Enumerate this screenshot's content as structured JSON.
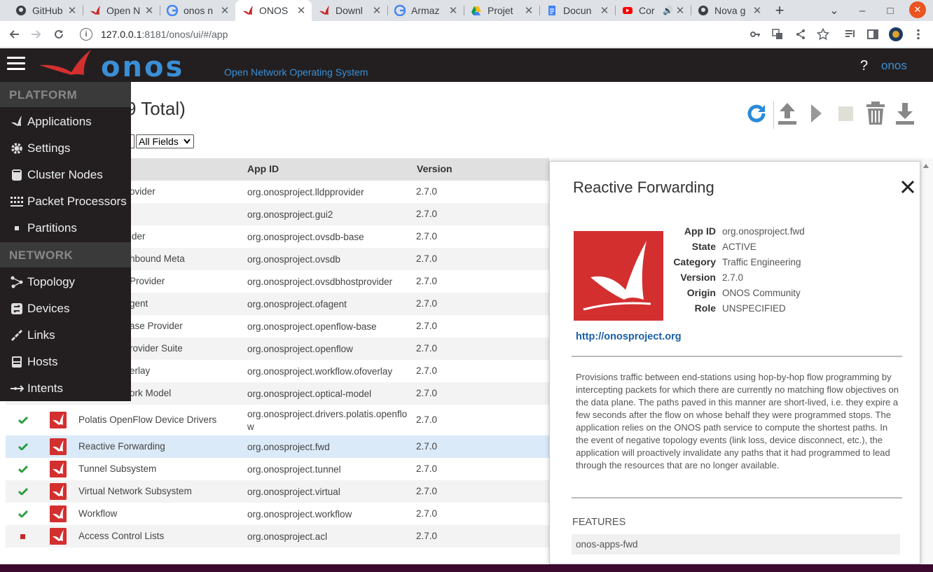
{
  "browser": {
    "tabs": [
      {
        "label": "GitHub",
        "icon": "github-icon",
        "active": false
      },
      {
        "label": "Open N",
        "icon": "onos-icon",
        "active": false
      },
      {
        "label": "onos n",
        "icon": "google-icon",
        "active": false
      },
      {
        "label": "ONOS",
        "icon": "onos-icon",
        "active": true
      },
      {
        "label": "Downl",
        "icon": "onos-icon",
        "active": false
      },
      {
        "label": "Armaz",
        "icon": "google-icon",
        "active": false
      },
      {
        "label": "Projet",
        "icon": "drive-icon",
        "active": false
      },
      {
        "label": "Docun",
        "icon": "docs-icon",
        "active": false
      },
      {
        "label": "Cor",
        "icon": "youtube-icon",
        "active": false
      },
      {
        "label": "Nova g",
        "icon": "github-icon",
        "active": false
      }
    ],
    "url_host": "127.0.0.1",
    "url_rest": ":8181/onos/ui/#/app"
  },
  "header": {
    "logo": "onos",
    "subtitle": "Open Network Operating System",
    "help": "?",
    "user": "onos"
  },
  "nav": {
    "platform_label": "PLATFORM",
    "platform_items": [
      "Applications",
      "Settings",
      "Cluster Nodes",
      "Packet Processors",
      "Partitions"
    ],
    "network_label": "NETWORK",
    "network_items": [
      "Topology",
      "Devices",
      "Links",
      "Hosts",
      "Intents"
    ]
  },
  "page": {
    "title": "9 Total)",
    "field_select": "All Fields"
  },
  "table": {
    "headers": {
      "app_id": "App ID",
      "version": "Version"
    },
    "rows": [
      {
        "title": "ovider",
        "app_id": "org.onosproject.lldpprovider",
        "version": "2.7.0",
        "status": "hidden"
      },
      {
        "title": "",
        "app_id": "org.onosproject.gui2",
        "version": "2.7.0",
        "status": "hidden"
      },
      {
        "title": "ider",
        "app_id": "org.onosproject.ovsdb-base",
        "version": "2.7.0",
        "status": "hidden"
      },
      {
        "title": "hbound Meta",
        "app_id": "org.onosproject.ovsdb",
        "version": "2.7.0",
        "status": "hidden"
      },
      {
        "title": "Provider",
        "app_id": "org.onosproject.ovsdbhostprovider",
        "version": "2.7.0",
        "status": "hidden"
      },
      {
        "title": "gent",
        "app_id": "org.onosproject.ofagent",
        "version": "2.7.0",
        "status": "hidden"
      },
      {
        "title": "ase Provider",
        "app_id": "org.onosproject.openflow-base",
        "version": "2.7.0",
        "status": "hidden"
      },
      {
        "title": "rovider Suite",
        "app_id": "org.onosproject.openflow",
        "version": "2.7.0",
        "status": "hidden"
      },
      {
        "title": "erlay",
        "app_id": "org.onosproject.workflow.ofoverlay",
        "version": "2.7.0",
        "status": "hidden"
      },
      {
        "title": "ork Model",
        "app_id": "org.onosproject.optical-model",
        "version": "2.7.0",
        "status": "hidden"
      },
      {
        "title": "Polatis OpenFlow Device Drivers",
        "app_id": "org.onosproject.drivers.polatis.openflo",
        "app_id2": "w",
        "version": "2.7.0",
        "status": "active"
      },
      {
        "title": "Reactive Forwarding",
        "app_id": "org.onosproject.fwd",
        "version": "2.7.0",
        "status": "active"
      },
      {
        "title": "Tunnel Subsystem",
        "app_id": "org.onosproject.tunnel",
        "version": "2.7.0",
        "status": "active"
      },
      {
        "title": "Virtual Network Subsystem",
        "app_id": "org.onosproject.virtual",
        "version": "2.7.0",
        "status": "active"
      },
      {
        "title": "Workflow",
        "app_id": "org.onosproject.workflow",
        "version": "2.7.0",
        "status": "active"
      },
      {
        "title": "Access Control Lists",
        "app_id": "org.onosproject.acl",
        "version": "2.7.0",
        "status": "inactive"
      }
    ]
  },
  "detail": {
    "title": "Reactive Forwarding",
    "props": [
      {
        "k": "App ID",
        "v": "org.onosproject.fwd"
      },
      {
        "k": "State",
        "v": "ACTIVE"
      },
      {
        "k": "Category",
        "v": "Traffic Engineering"
      },
      {
        "k": "Version",
        "v": "2.7.0"
      },
      {
        "k": "Origin",
        "v": "ONOS Community"
      },
      {
        "k": "Role",
        "v": "UNSPECIFIED"
      }
    ],
    "link": "http://onosproject.org",
    "description": "Provisions traffic between end-stations using hop-by-hop flow programming by intercepting packets for which there are currently no matching flow objectives on the data plane. The paths paved in this manner are short-lived, i.e. they expire a few seconds after the flow on whose behalf they were programmed stops. The application relies on the ONOS path service to compute the shortest paths. In the event of negative topology events (link loss, device disconnect, etc.), the application will proactively invalidate any paths that it had programmed to lead through the resources that are no longer available.",
    "features_label": "FEATURES",
    "features": [
      "onos-apps-fwd"
    ]
  },
  "colors": {
    "onos_blue": "#3a8fd6",
    "onos_red": "#d32f2f",
    "check_green": "#2e9e44",
    "header_bg": "#231f20"
  }
}
